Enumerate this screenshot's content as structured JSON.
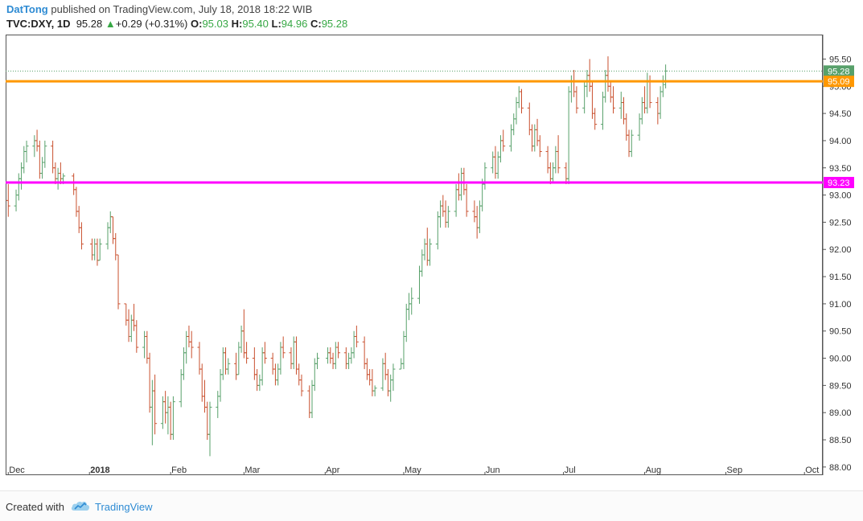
{
  "header": {
    "author": "DatTong",
    "published_text": "published on TradingView.com, July 18, 2018 18:22 WIB",
    "symbol": "TVC:DXY, 1D",
    "last": "95.28",
    "change_arrow": "▲",
    "change": "+0.29 (+0.31%)",
    "o_label": "O:",
    "o_value": "95.03",
    "h_label": "H:",
    "h_value": "95.40",
    "l_label": "L:",
    "l_value": "94.96",
    "c_label": "C:",
    "c_value": "95.28"
  },
  "footer": {
    "created_with": "Created with",
    "brand": "TradingView",
    "logo_icon": "tradingview-cloud-icon"
  },
  "colors": {
    "up": "#57a06a",
    "down": "#c9502e",
    "orange_line": "#ff9800",
    "magenta_line": "#ff00ff",
    "last_price_tag": "#57a06a",
    "grid": "#e8e8e8"
  },
  "chart_data": {
    "type": "ohlc",
    "y_axis_ticks": [
      "95.50",
      "95.00",
      "94.50",
      "94.00",
      "93.50",
      "93.00",
      "92.50",
      "92.00",
      "91.50",
      "91.00",
      "90.50",
      "90.00",
      "89.50",
      "89.00",
      "88.50",
      "88.00"
    ],
    "ylim": [
      87.85,
      95.95
    ],
    "x_axis_ticks": [
      {
        "label": "Dec",
        "date": "2017-12-01"
      },
      {
        "label": "2018",
        "date": "2018-01-01"
      },
      {
        "label": "Feb",
        "date": "2018-02-01"
      },
      {
        "label": "Mar",
        "date": "2018-03-01"
      },
      {
        "label": "Apr",
        "date": "2018-04-01"
      },
      {
        "label": "May",
        "date": "2018-05-01"
      },
      {
        "label": "Jun",
        "date": "2018-06-01"
      },
      {
        "label": "Jul",
        "date": "2018-07-01"
      },
      {
        "label": "Aug",
        "date": "2018-08-01"
      },
      {
        "label": "Sep",
        "date": "2018-09-01"
      },
      {
        "label": "Oct",
        "date": "2018-10-01"
      }
    ],
    "xlim": [
      "2017-11-30",
      "2018-10-08"
    ],
    "horizontal_lines": [
      {
        "value": 95.09,
        "label": "95.09",
        "color": "#ff9800"
      },
      {
        "value": 93.23,
        "label": "93.23",
        "color": "#ff00ff"
      }
    ],
    "last_price": {
      "value": 95.28,
      "label": "95.28"
    },
    "grid": false,
    "bars": [
      [
        "2017-12-01",
        92.9,
        93.2,
        92.6,
        92.8
      ],
      [
        "2017-12-04",
        92.8,
        93.1,
        92.7,
        93.0
      ],
      [
        "2017-12-05",
        93.0,
        93.4,
        92.9,
        93.3
      ],
      [
        "2017-12-06",
        93.3,
        93.6,
        93.1,
        93.5
      ],
      [
        "2017-12-07",
        93.5,
        93.9,
        93.4,
        93.8
      ],
      [
        "2017-12-08",
        93.8,
        94.0,
        93.6,
        93.9
      ],
      [
        "2017-12-11",
        93.9,
        94.1,
        93.7,
        94.0
      ],
      [
        "2017-12-12",
        94.0,
        94.2,
        93.8,
        93.9
      ],
      [
        "2017-12-13",
        93.9,
        94.0,
        93.3,
        93.4
      ],
      [
        "2017-12-14",
        93.4,
        93.7,
        93.3,
        93.6
      ],
      [
        "2017-12-15",
        93.6,
        94.0,
        93.5,
        93.9
      ],
      [
        "2017-12-18",
        93.9,
        94.0,
        93.4,
        93.5
      ],
      [
        "2017-12-19",
        93.5,
        93.6,
        93.2,
        93.3
      ],
      [
        "2017-12-20",
        93.3,
        93.5,
        93.1,
        93.4
      ],
      [
        "2017-12-21",
        93.4,
        93.6,
        93.2,
        93.3
      ],
      [
        "2017-12-22",
        93.3,
        93.4,
        93.2,
        93.35
      ],
      [
        "2017-12-26",
        93.35,
        93.4,
        93.0,
        93.1
      ],
      [
        "2017-12-27",
        93.1,
        93.15,
        92.6,
        92.7
      ],
      [
        "2017-12-28",
        92.7,
        92.8,
        92.3,
        92.4
      ],
      [
        "2017-12-29",
        92.4,
        92.5,
        92.0,
        92.1
      ],
      [
        "2018-01-02",
        92.1,
        92.2,
        91.8,
        91.9
      ],
      [
        "2018-01-03",
        91.9,
        92.2,
        91.8,
        92.1
      ],
      [
        "2018-01-04",
        92.1,
        92.2,
        91.7,
        91.8
      ],
      [
        "2018-01-05",
        91.8,
        92.2,
        91.8,
        92.1
      ],
      [
        "2018-01-08",
        92.1,
        92.5,
        92.0,
        92.4
      ],
      [
        "2018-01-09",
        92.4,
        92.7,
        92.3,
        92.6
      ],
      [
        "2018-01-10",
        92.6,
        92.6,
        92.1,
        92.2
      ],
      [
        "2018-01-11",
        92.2,
        92.3,
        91.8,
        91.9
      ],
      [
        "2018-01-12",
        91.9,
        91.9,
        90.9,
        91.0
      ],
      [
        "2018-01-15",
        91.0,
        91.0,
        90.6,
        90.7
      ],
      [
        "2018-01-16",
        90.7,
        90.9,
        90.3,
        90.4
      ],
      [
        "2018-01-17",
        90.4,
        90.8,
        90.3,
        90.7
      ],
      [
        "2018-01-18",
        90.7,
        91.0,
        90.5,
        90.6
      ],
      [
        "2018-01-19",
        90.6,
        90.7,
        90.1,
        90.2
      ],
      [
        "2018-01-22",
        90.2,
        90.5,
        90.0,
        90.4
      ],
      [
        "2018-01-23",
        90.4,
        90.5,
        89.9,
        90.0
      ],
      [
        "2018-01-24",
        90.0,
        90.1,
        89.0,
        89.1
      ],
      [
        "2018-01-25",
        89.1,
        89.6,
        88.4,
        89.4
      ],
      [
        "2018-01-26",
        89.4,
        89.7,
        88.6,
        88.8
      ],
      [
        "2018-01-29",
        88.8,
        89.3,
        88.7,
        89.2
      ],
      [
        "2018-01-30",
        89.2,
        89.4,
        88.8,
        89.0
      ],
      [
        "2018-01-31",
        89.0,
        89.3,
        88.6,
        89.1
      ],
      [
        "2018-02-01",
        89.1,
        89.2,
        88.5,
        88.6
      ],
      [
        "2018-02-02",
        88.6,
        89.3,
        88.5,
        89.2
      ],
      [
        "2018-02-05",
        89.2,
        89.8,
        89.1,
        89.7
      ],
      [
        "2018-02-06",
        89.7,
        90.2,
        89.6,
        90.1
      ],
      [
        "2018-02-07",
        90.1,
        90.5,
        89.9,
        90.4
      ],
      [
        "2018-02-08",
        90.4,
        90.6,
        90.2,
        90.3
      ],
      [
        "2018-02-09",
        90.3,
        90.5,
        90.0,
        90.2
      ],
      [
        "2018-02-12",
        90.2,
        90.3,
        89.7,
        89.8
      ],
      [
        "2018-02-13",
        89.8,
        89.9,
        89.2,
        89.3
      ],
      [
        "2018-02-14",
        89.3,
        89.6,
        89.0,
        89.1
      ],
      [
        "2018-02-15",
        89.1,
        89.2,
        88.5,
        88.6
      ],
      [
        "2018-02-16",
        88.6,
        89.2,
        88.2,
        89.1
      ],
      [
        "2018-02-19",
        89.1,
        89.4,
        88.9,
        89.3
      ],
      [
        "2018-02-20",
        89.3,
        89.8,
        89.2,
        89.7
      ],
      [
        "2018-02-21",
        89.7,
        90.2,
        89.6,
        90.1
      ],
      [
        "2018-02-22",
        90.1,
        90.2,
        89.7,
        89.8
      ],
      [
        "2018-02-23",
        89.8,
        90.0,
        89.7,
        89.9
      ],
      [
        "2018-02-26",
        89.9,
        90.1,
        89.6,
        89.7
      ],
      [
        "2018-02-27",
        89.7,
        90.3,
        89.7,
        90.2
      ],
      [
        "2018-02-28",
        90.2,
        90.6,
        90.1,
        90.5
      ],
      [
        "2018-03-01",
        90.5,
        90.9,
        90.0,
        90.1
      ],
      [
        "2018-03-02",
        90.1,
        90.3,
        89.9,
        90.0
      ],
      [
        "2018-03-05",
        90.0,
        90.2,
        89.6,
        89.7
      ],
      [
        "2018-03-06",
        89.7,
        89.8,
        89.4,
        89.5
      ],
      [
        "2018-03-07",
        89.5,
        89.7,
        89.4,
        89.6
      ],
      [
        "2018-03-08",
        89.6,
        90.2,
        89.5,
        90.1
      ],
      [
        "2018-03-09",
        90.1,
        90.3,
        89.9,
        90.0
      ],
      [
        "2018-03-12",
        90.0,
        90.1,
        89.7,
        89.8
      ],
      [
        "2018-03-13",
        89.8,
        89.9,
        89.5,
        89.6
      ],
      [
        "2018-03-14",
        89.6,
        89.9,
        89.5,
        89.8
      ],
      [
        "2018-03-15",
        89.8,
        90.3,
        89.7,
        90.2
      ],
      [
        "2018-03-16",
        90.2,
        90.4,
        90.0,
        90.1
      ],
      [
        "2018-03-19",
        90.1,
        90.2,
        89.8,
        89.9
      ],
      [
        "2018-03-20",
        89.9,
        90.4,
        89.8,
        90.3
      ],
      [
        "2018-03-21",
        90.3,
        90.4,
        89.7,
        89.8
      ],
      [
        "2018-03-22",
        89.8,
        89.9,
        89.5,
        89.6
      ],
      [
        "2018-03-23",
        89.6,
        89.7,
        89.3,
        89.4
      ],
      [
        "2018-03-26",
        89.4,
        89.5,
        88.9,
        89.0
      ],
      [
        "2018-03-27",
        89.0,
        89.6,
        88.9,
        89.5
      ],
      [
        "2018-03-28",
        89.5,
        90.0,
        89.4,
        89.9
      ],
      [
        "2018-03-29",
        89.9,
        90.1,
        89.8,
        90.0
      ],
      [
        "2018-04-02",
        90.0,
        90.2,
        89.9,
        90.1
      ],
      [
        "2018-04-03",
        90.1,
        90.2,
        89.9,
        90.0
      ],
      [
        "2018-04-04",
        90.0,
        90.1,
        89.8,
        89.9
      ],
      [
        "2018-04-05",
        89.9,
        90.3,
        89.8,
        90.2
      ],
      [
        "2018-04-06",
        90.2,
        90.3,
        90.0,
        90.1
      ],
      [
        "2018-04-09",
        90.1,
        90.2,
        89.8,
        89.9
      ],
      [
        "2018-04-10",
        89.9,
        90.1,
        89.8,
        90.0
      ],
      [
        "2018-04-11",
        90.0,
        90.2,
        89.9,
        90.1
      ],
      [
        "2018-04-12",
        90.1,
        90.5,
        90.0,
        90.4
      ],
      [
        "2018-04-13",
        90.4,
        90.6,
        90.2,
        90.3
      ],
      [
        "2018-04-16",
        90.3,
        90.4,
        89.8,
        89.9
      ],
      [
        "2018-04-17",
        89.9,
        90.0,
        89.6,
        89.7
      ],
      [
        "2018-04-18",
        89.7,
        89.8,
        89.5,
        89.6
      ],
      [
        "2018-04-19",
        89.6,
        89.8,
        89.3,
        89.4
      ],
      [
        "2018-04-20",
        89.4,
        89.5,
        89.3,
        89.45
      ],
      [
        "2018-04-23",
        89.45,
        90.0,
        89.4,
        89.9
      ],
      [
        "2018-04-24",
        89.9,
        90.1,
        89.6,
        89.7
      ],
      [
        "2018-04-25",
        89.7,
        89.8,
        89.3,
        89.4
      ],
      [
        "2018-04-26",
        89.4,
        89.7,
        89.2,
        89.6
      ],
      [
        "2018-04-27",
        89.6,
        89.9,
        89.4,
        89.8
      ],
      [
        "2018-04-30",
        89.8,
        90.0,
        89.8,
        89.9
      ],
      [
        "2018-05-01",
        89.9,
        90.5,
        89.8,
        90.4
      ],
      [
        "2018-05-02",
        90.4,
        91.0,
        90.3,
        90.9
      ],
      [
        "2018-05-03",
        90.9,
        91.2,
        90.7,
        91.0
      ],
      [
        "2018-05-04",
        91.0,
        91.3,
        90.8,
        91.1
      ],
      [
        "2018-05-07",
        91.1,
        91.7,
        91.0,
        91.6
      ],
      [
        "2018-05-08",
        91.6,
        92.0,
        91.5,
        91.9
      ],
      [
        "2018-05-09",
        91.9,
        92.2,
        91.8,
        92.1
      ],
      [
        "2018-05-10",
        92.1,
        92.4,
        91.7,
        91.8
      ],
      [
        "2018-05-11",
        91.8,
        92.2,
        91.7,
        92.1
      ],
      [
        "2018-05-14",
        92.1,
        92.7,
        92.0,
        92.6
      ],
      [
        "2018-05-15",
        92.6,
        92.9,
        92.4,
        92.8
      ],
      [
        "2018-05-16",
        92.8,
        93.0,
        92.6,
        92.7
      ],
      [
        "2018-05-17",
        92.7,
        92.9,
        92.4,
        92.5
      ],
      [
        "2018-05-18",
        92.5,
        92.8,
        92.4,
        92.7
      ],
      [
        "2018-05-21",
        92.7,
        93.2,
        92.6,
        93.1
      ],
      [
        "2018-05-22",
        93.1,
        93.4,
        92.9,
        93.0
      ],
      [
        "2018-05-23",
        93.0,
        93.5,
        92.9,
        93.4
      ],
      [
        "2018-05-24",
        93.4,
        93.5,
        93.0,
        93.1
      ],
      [
        "2018-05-25",
        93.1,
        93.2,
        92.6,
        92.7
      ],
      [
        "2018-05-28",
        92.7,
        92.9,
        92.5,
        92.6
      ],
      [
        "2018-05-29",
        92.6,
        92.8,
        92.2,
        92.4
      ],
      [
        "2018-05-30",
        92.4,
        92.9,
        92.3,
        92.8
      ],
      [
        "2018-05-31",
        92.8,
        93.3,
        92.7,
        93.2
      ],
      [
        "2018-06-01",
        93.2,
        93.6,
        93.1,
        93.5
      ],
      [
        "2018-06-04",
        93.5,
        93.8,
        93.4,
        93.7
      ],
      [
        "2018-06-05",
        93.7,
        93.9,
        93.3,
        93.4
      ],
      [
        "2018-06-06",
        93.4,
        93.8,
        93.3,
        93.7
      ],
      [
        "2018-06-07",
        93.7,
        94.1,
        93.6,
        94.0
      ],
      [
        "2018-06-08",
        94.0,
        94.2,
        93.8,
        93.9
      ],
      [
        "2018-06-11",
        93.9,
        94.3,
        93.8,
        94.2
      ],
      [
        "2018-06-12",
        94.2,
        94.5,
        94.1,
        94.4
      ],
      [
        "2018-06-13",
        94.4,
        94.8,
        94.3,
        94.7
      ],
      [
        "2018-06-14",
        94.7,
        95.0,
        94.6,
        94.9
      ],
      [
        "2018-06-15",
        94.9,
        94.95,
        94.5,
        94.6
      ],
      [
        "2018-06-18",
        94.6,
        94.7,
        94.1,
        94.2
      ],
      [
        "2018-06-19",
        94.2,
        94.3,
        93.8,
        93.9
      ],
      [
        "2018-06-20",
        93.9,
        94.3,
        93.8,
        94.2
      ],
      [
        "2018-06-21",
        94.2,
        94.4,
        93.9,
        94.0
      ],
      [
        "2018-06-22",
        94.0,
        94.1,
        93.7,
        93.8
      ],
      [
        "2018-06-25",
        93.8,
        93.9,
        93.4,
        93.5
      ],
      [
        "2018-06-26",
        93.5,
        93.6,
        93.2,
        93.3
      ],
      [
        "2018-06-27",
        93.3,
        93.6,
        93.25,
        93.5
      ],
      [
        "2018-06-28",
        93.5,
        93.9,
        93.4,
        93.8
      ],
      [
        "2018-06-29",
        93.8,
        94.1,
        93.4,
        93.5
      ],
      [
        "2018-07-02",
        93.5,
        93.6,
        93.2,
        93.3
      ],
      [
        "2018-07-03",
        93.3,
        95.0,
        93.2,
        94.9
      ],
      [
        "2018-07-04",
        94.9,
        95.2,
        94.7,
        95.1
      ],
      [
        "2018-07-05",
        95.1,
        95.3,
        94.8,
        94.9
      ],
      [
        "2018-07-06",
        94.9,
        95.0,
        94.5,
        94.6
      ],
      [
        "2018-07-09",
        94.6,
        95.1,
        94.5,
        95.0
      ],
      [
        "2018-07-10",
        95.0,
        95.3,
        94.8,
        95.2
      ],
      [
        "2018-07-11",
        95.2,
        95.5,
        94.9,
        95.0
      ],
      [
        "2018-07-12",
        95.0,
        95.1,
        94.4,
        94.5
      ],
      [
        "2018-07-13",
        94.5,
        94.6,
        94.2,
        94.3
      ],
      [
        "2018-07-16",
        94.3,
        94.9,
        94.2,
        94.8
      ],
      [
        "2018-07-17",
        94.8,
        95.3,
        94.7,
        95.2
      ],
      [
        "2018-07-18",
        95.2,
        95.55,
        94.9,
        95.0
      ],
      [
        "2018-07-19",
        95.0,
        95.1,
        94.7,
        94.8
      ],
      [
        "2018-07-20",
        94.8,
        95.0,
        94.5,
        94.6
      ],
      [
        "2018-07-23",
        94.6,
        94.9,
        94.4,
        94.7
      ],
      [
        "2018-07-24",
        94.7,
        94.8,
        94.3,
        94.4
      ],
      [
        "2018-07-25",
        94.4,
        94.5,
        94.0,
        94.1
      ],
      [
        "2018-07-26",
        94.1,
        94.2,
        93.7,
        93.8
      ],
      [
        "2018-07-27",
        93.8,
        94.2,
        93.7,
        94.1
      ],
      [
        "2018-07-30",
        94.1,
        94.5,
        94.0,
        94.4
      ],
      [
        "2018-07-31",
        94.4,
        94.8,
        94.3,
        94.7
      ],
      [
        "2018-08-01",
        94.7,
        95.0,
        94.5,
        94.6
      ],
      [
        "2018-08-02",
        94.6,
        95.25,
        94.5,
        95.1
      ],
      [
        "2018-08-03",
        95.1,
        95.2,
        94.6,
        94.7
      ],
      [
        "2018-08-06",
        94.7,
        94.8,
        94.3,
        94.5
      ],
      [
        "2018-08-07",
        94.5,
        95.0,
        94.4,
        94.9
      ],
      [
        "2018-08-08",
        94.9,
        95.2,
        94.8,
        95.1
      ],
      [
        "2018-08-09",
        95.03,
        95.4,
        94.96,
        95.28
      ]
    ]
  }
}
